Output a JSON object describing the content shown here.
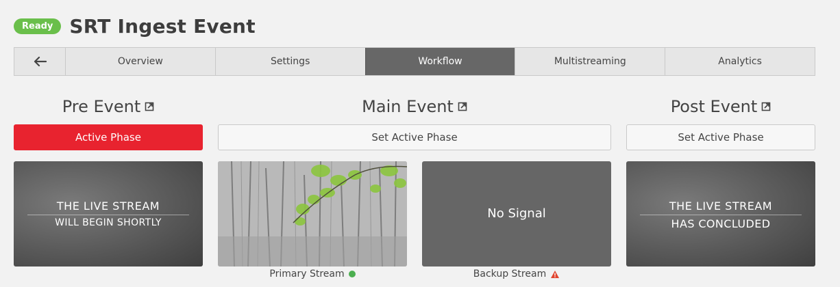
{
  "header": {
    "status": "Ready",
    "title": "SRT Ingest Event",
    "status_color": "#6abf4b"
  },
  "tabs": [
    {
      "label": "Overview"
    },
    {
      "label": "Settings"
    },
    {
      "label": "Workflow",
      "active": true
    },
    {
      "label": "Multistreaming"
    },
    {
      "label": "Analytics"
    }
  ],
  "phases": {
    "pre": {
      "title": "Pre Event",
      "button": "Active Phase",
      "slate_line1": "THE LIVE STREAM",
      "slate_line2": "WILL BEGIN SHORTLY"
    },
    "main": {
      "title": "Main Event",
      "button": "Set Active Phase",
      "primary_caption": "Primary Stream",
      "backup_caption": "Backup Stream",
      "backup_text": "No Signal"
    },
    "post": {
      "title": "Post Event",
      "button": "Set Active Phase",
      "slate_line1": "THE LIVE STREAM",
      "slate_line2": "HAS CONCLUDED"
    }
  },
  "colors": {
    "active_phase": "#e8232f",
    "active_tab": "#676767",
    "ok": "#4caf50",
    "warn": "#e0442e"
  },
  "icons": [
    "arrow-left-icon",
    "external-link-icon",
    "status-ok-icon",
    "warning-icon"
  ]
}
